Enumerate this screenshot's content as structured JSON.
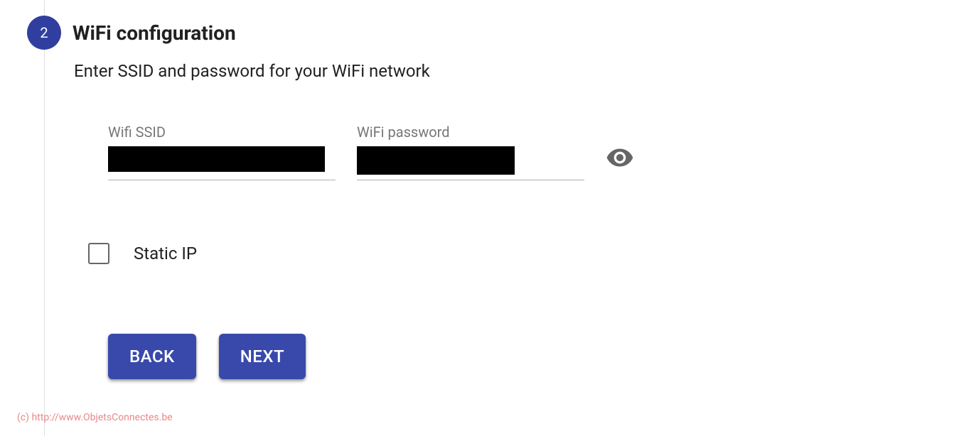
{
  "step": {
    "number": "2",
    "title": "WiFi configuration",
    "description": "Enter SSID and password for your WiFi network"
  },
  "fields": {
    "ssid": {
      "label": "Wifi SSID",
      "value": ""
    },
    "password": {
      "label": "WiFi password",
      "value": ""
    }
  },
  "static_ip": {
    "label": "Static IP",
    "checked": false
  },
  "buttons": {
    "back": "BACK",
    "next": "NEXT"
  },
  "copyright": "(c) http://www.ObjetsConnectes.be"
}
